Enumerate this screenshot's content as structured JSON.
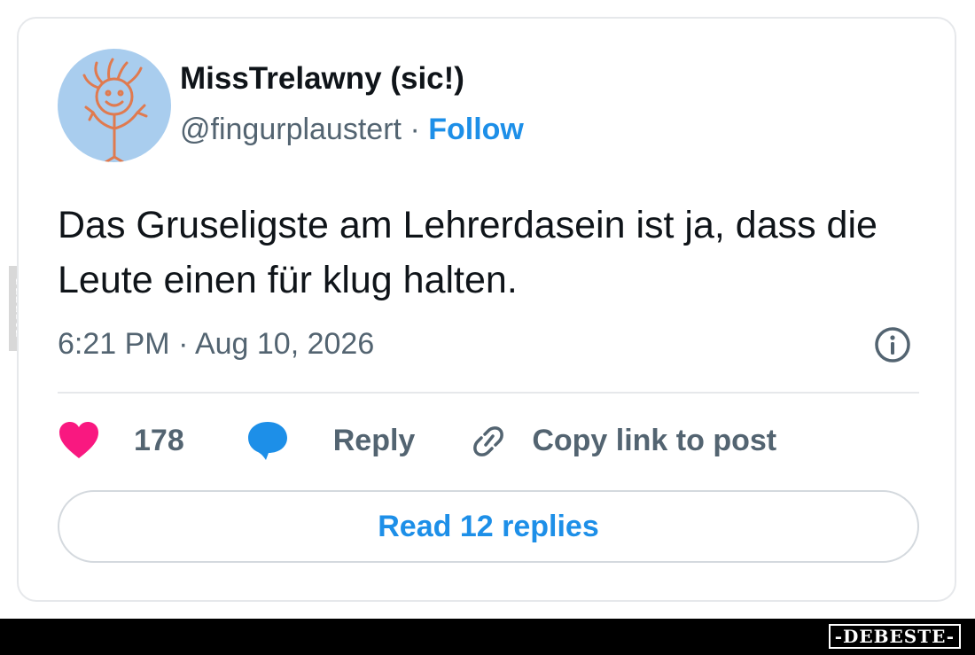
{
  "tweet": {
    "author_name": "MissTrelawny (sic!)",
    "handle": "@fingurplaustert",
    "separator": "·",
    "follow_label": "Follow",
    "text": "Das Gruseligste am Lehrerdasein ist ja, dass die Leute einen für klug halten.",
    "timestamp": "6:21 PM · Aug 10, 2026",
    "like_count": "178",
    "reply_label": "Reply",
    "copy_link_label": "Copy link to post",
    "read_replies_label": "Read 12 replies"
  },
  "watermark": {
    "side_text": "DEBESTE",
    "footer_logo": "-DEBESTE-"
  },
  "icons": {
    "heart": "heart-icon",
    "reply": "speech-bubble-icon",
    "link": "link-icon",
    "info": "info-icon"
  },
  "colors": {
    "accent": "#1d8fe8",
    "heart": "#f91880",
    "text": "#0f1419",
    "muted": "#536471",
    "avatar_bg": "#a9cdee",
    "avatar_drawing": "#e07a4f"
  }
}
